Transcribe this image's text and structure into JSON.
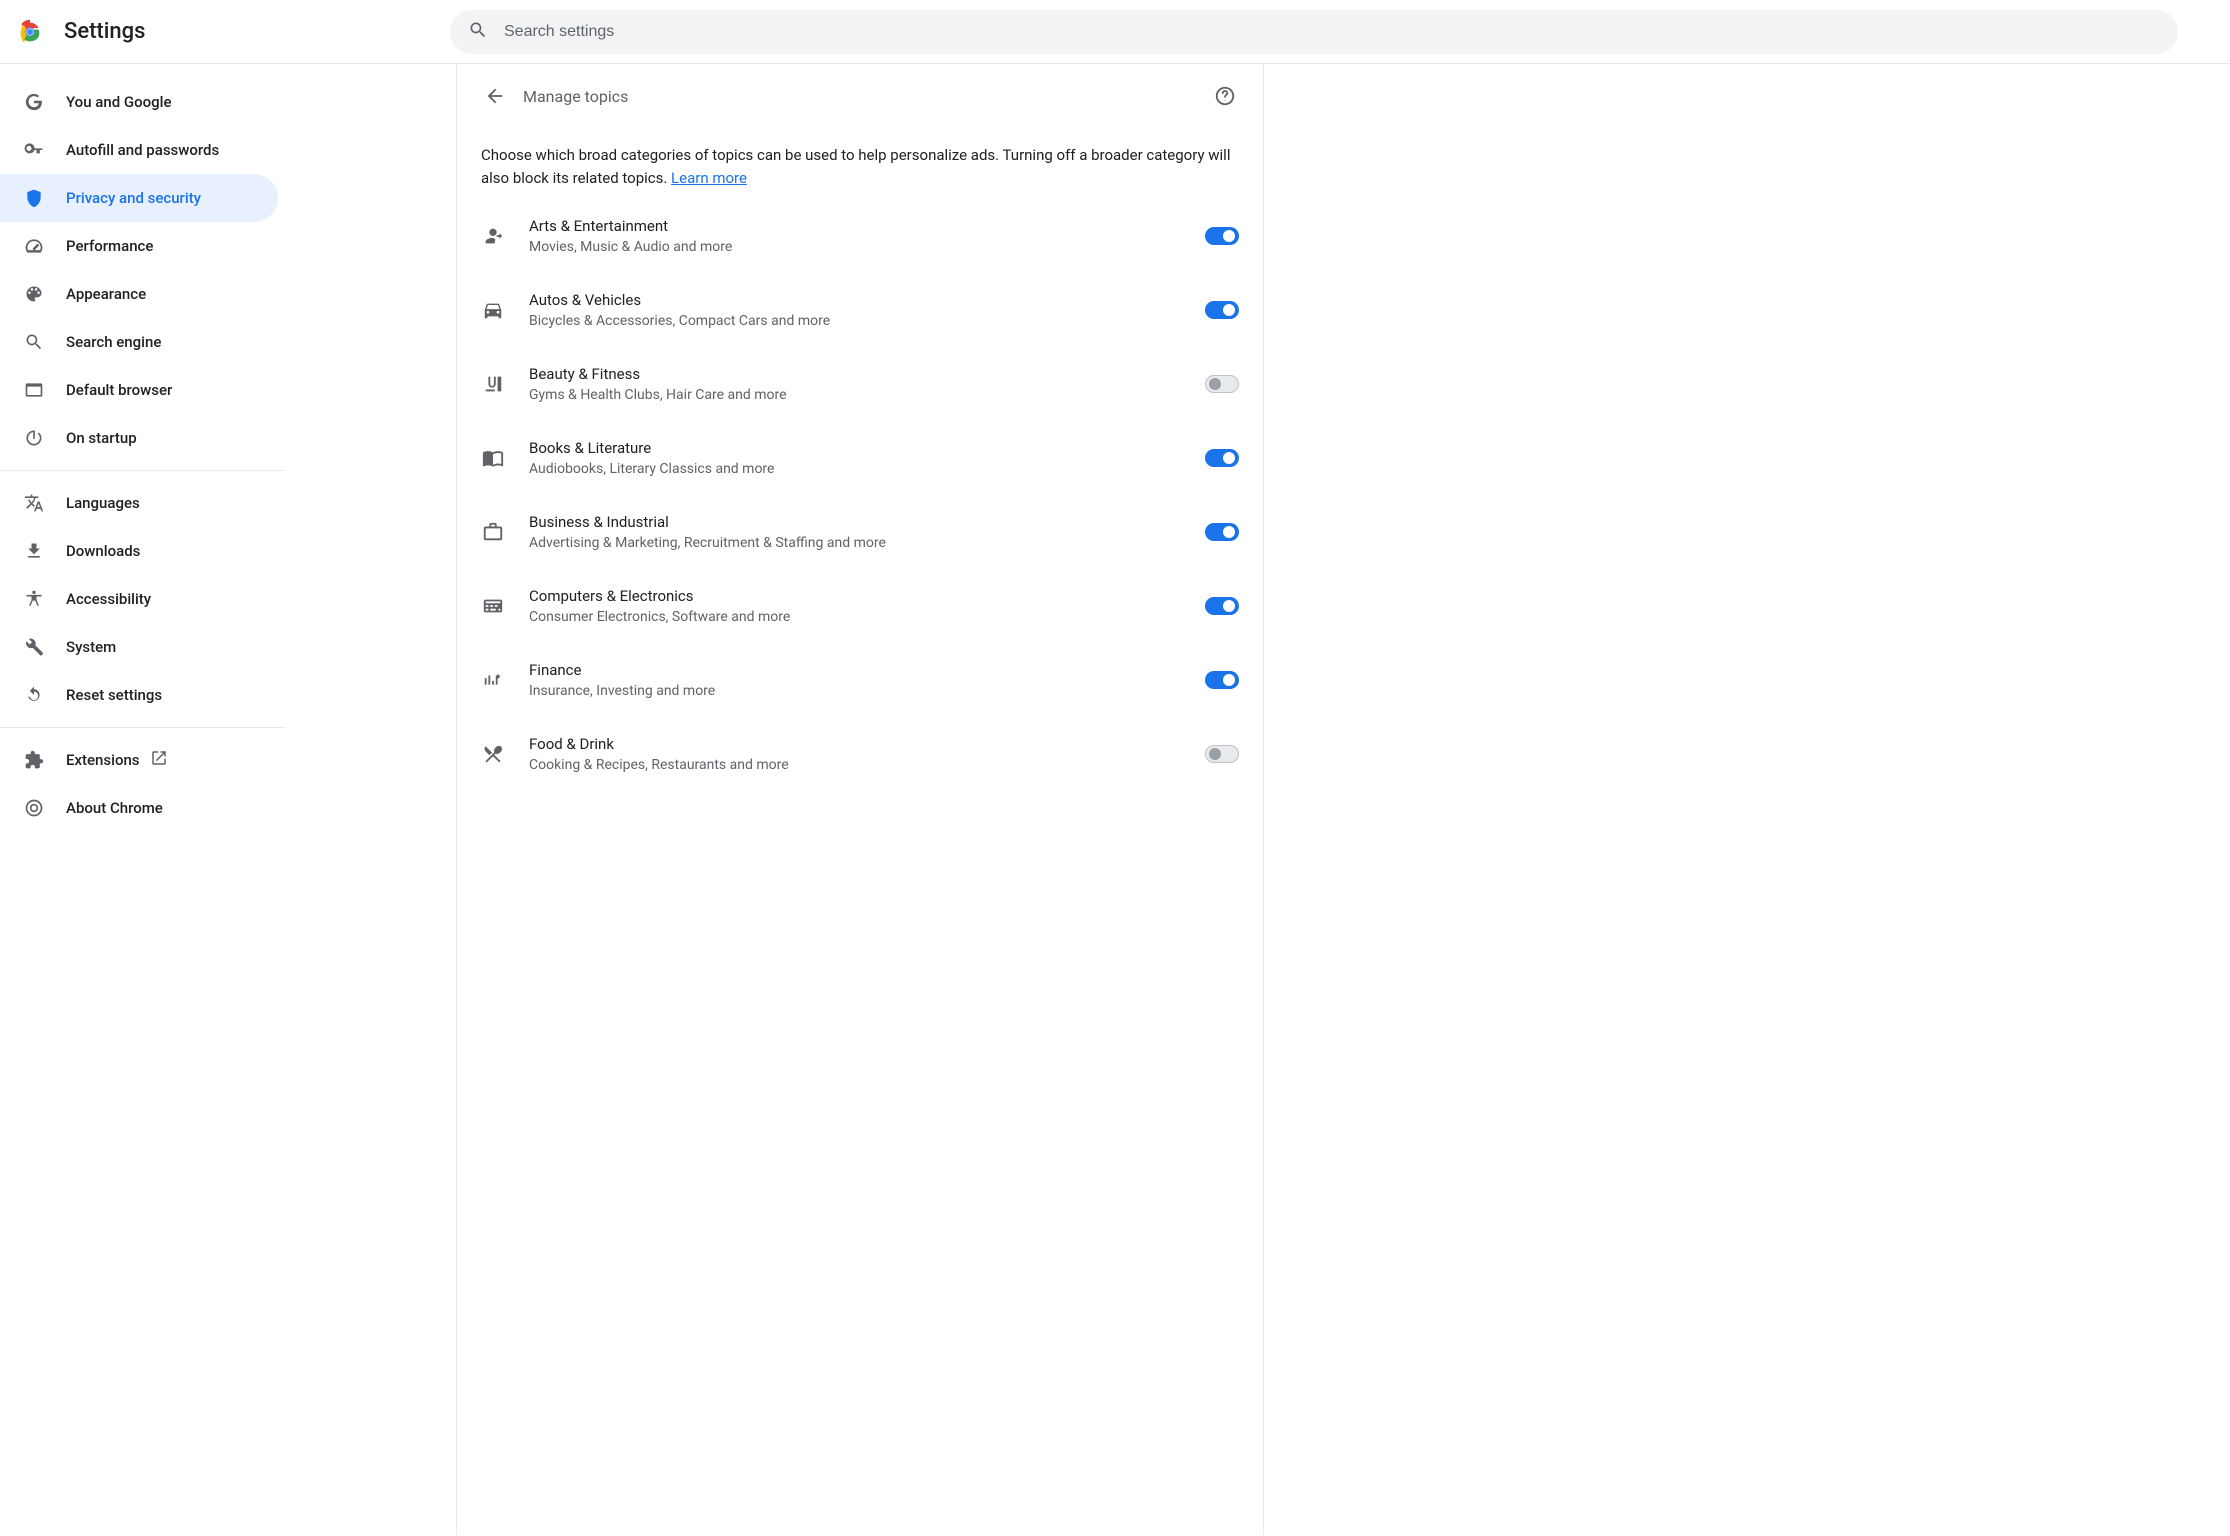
{
  "header": {
    "title": "Settings",
    "search_placeholder": "Search settings"
  },
  "sidebar": {
    "items": [
      {
        "id": "you-and-google",
        "label": "You and Google"
      },
      {
        "id": "autofill",
        "label": "Autofill and passwords"
      },
      {
        "id": "privacy",
        "label": "Privacy and security"
      },
      {
        "id": "performance",
        "label": "Performance"
      },
      {
        "id": "appearance",
        "label": "Appearance"
      },
      {
        "id": "search-engine",
        "label": "Search engine"
      },
      {
        "id": "default-browser",
        "label": "Default browser"
      },
      {
        "id": "on-startup",
        "label": "On startup"
      }
    ],
    "items2": [
      {
        "id": "languages",
        "label": "Languages"
      },
      {
        "id": "downloads",
        "label": "Downloads"
      },
      {
        "id": "accessibility",
        "label": "Accessibility"
      },
      {
        "id": "system",
        "label": "System"
      },
      {
        "id": "reset",
        "label": "Reset settings"
      }
    ],
    "items3": [
      {
        "id": "extensions",
        "label": "Extensions"
      },
      {
        "id": "about",
        "label": "About Chrome"
      }
    ]
  },
  "page": {
    "title": "Manage topics",
    "description_pre": "Choose which broad categories of topics can be used to help personalize ads. Turning off a broader category will also block its related topics. ",
    "learn_more": "Learn more"
  },
  "topics": [
    {
      "title": "Arts & Entertainment",
      "sub": "Movies, Music & Audio and more",
      "on": true
    },
    {
      "title": "Autos & Vehicles",
      "sub": "Bicycles & Accessories, Compact Cars and more",
      "on": true
    },
    {
      "title": "Beauty & Fitness",
      "sub": "Gyms & Health Clubs, Hair Care and more",
      "on": false
    },
    {
      "title": "Books & Literature",
      "sub": "Audiobooks, Literary Classics and more",
      "on": true
    },
    {
      "title": "Business & Industrial",
      "sub": "Advertising & Marketing, Recruitment & Staffing and more",
      "on": true
    },
    {
      "title": "Computers & Electronics",
      "sub": "Consumer Electronics, Software and more",
      "on": true
    },
    {
      "title": "Finance",
      "sub": "Insurance, Investing and more",
      "on": true
    },
    {
      "title": "Food & Drink",
      "sub": "Cooking & Recipes, Restaurants and more",
      "on": false
    }
  ]
}
